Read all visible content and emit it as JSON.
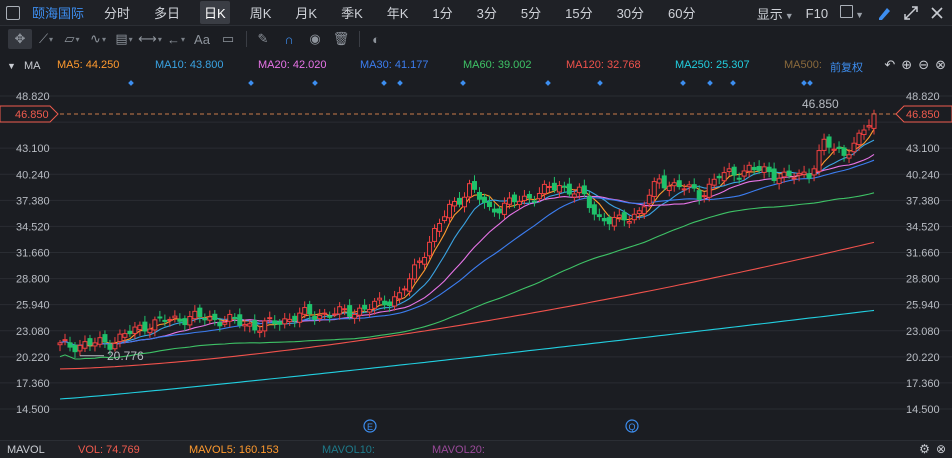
{
  "topbar": {
    "stock_name": "颐海国际",
    "periods": [
      "分时",
      "多日",
      "日K",
      "周K",
      "月K",
      "季K",
      "年K",
      "1分",
      "3分",
      "5分",
      "15分",
      "30分",
      "60分"
    ],
    "active_period": "日K",
    "display_label": "显示",
    "f10_label": "F10"
  },
  "legend": {
    "title": "MA",
    "items": [
      {
        "label": "MA5: 44.250",
        "color": "#ff9a2e"
      },
      {
        "label": "MA10: 43.800",
        "color": "#3aa3e3"
      },
      {
        "label": "MA20: 42.020",
        "color": "#e874e8"
      },
      {
        "label": "MA30: 41.177",
        "color": "#3c7df0"
      },
      {
        "label": "MA60: 39.002",
        "color": "#3ec266"
      },
      {
        "label": "MA120: 32.768",
        "color": "#f0524c"
      },
      {
        "label": "MA250: 25.307",
        "color": "#22cfe0"
      },
      {
        "label": "MA500: ",
        "color": "#8a6a3c"
      }
    ],
    "adjust_label": "前复权"
  },
  "price_axis": {
    "left_labels": [
      "48.820",
      "43.100",
      "40.240",
      "37.380",
      "34.520",
      "31.660",
      "28.800",
      "25.940",
      "23.080",
      "20.220",
      "17.360",
      "14.500"
    ],
    "right_labels": [
      "48.820",
      "43.100",
      "40.240",
      "37.380",
      "34.520",
      "31.660",
      "28.800",
      "25.940",
      "23.080",
      "20.220",
      "17.360",
      "14.500"
    ],
    "current_price": "46.850",
    "high_annotation": "46.850",
    "low_annotation": "20.776"
  },
  "event_markers": [
    "E",
    "Q"
  ],
  "volume": {
    "title": "MAVOL",
    "vol": "VOL: 74.769",
    "mavol5": "MAVOL5: 160.153",
    "mavol10": "MAVOL10:",
    "mavol20": "MAVOL20:"
  },
  "colors": {
    "up": "#ef4040",
    "down": "#1fc16b",
    "accent": "#3d8ef0",
    "current_price": "#ef5b4e"
  },
  "chart_data": {
    "type": "candlestick",
    "ylim": [
      14.5,
      48.82
    ],
    "ma_series": [
      {
        "name": "MA5",
        "last": 44.25
      },
      {
        "name": "MA10",
        "last": 43.8
      },
      {
        "name": "MA20",
        "last": 42.02
      },
      {
        "name": "MA30",
        "last": 41.177
      },
      {
        "name": "MA60",
        "last": 39.002
      },
      {
        "name": "MA120",
        "last": 32.768
      },
      {
        "name": "MA250",
        "last": 25.307
      }
    ],
    "last_close": 46.85,
    "low_marked": 20.776
  }
}
